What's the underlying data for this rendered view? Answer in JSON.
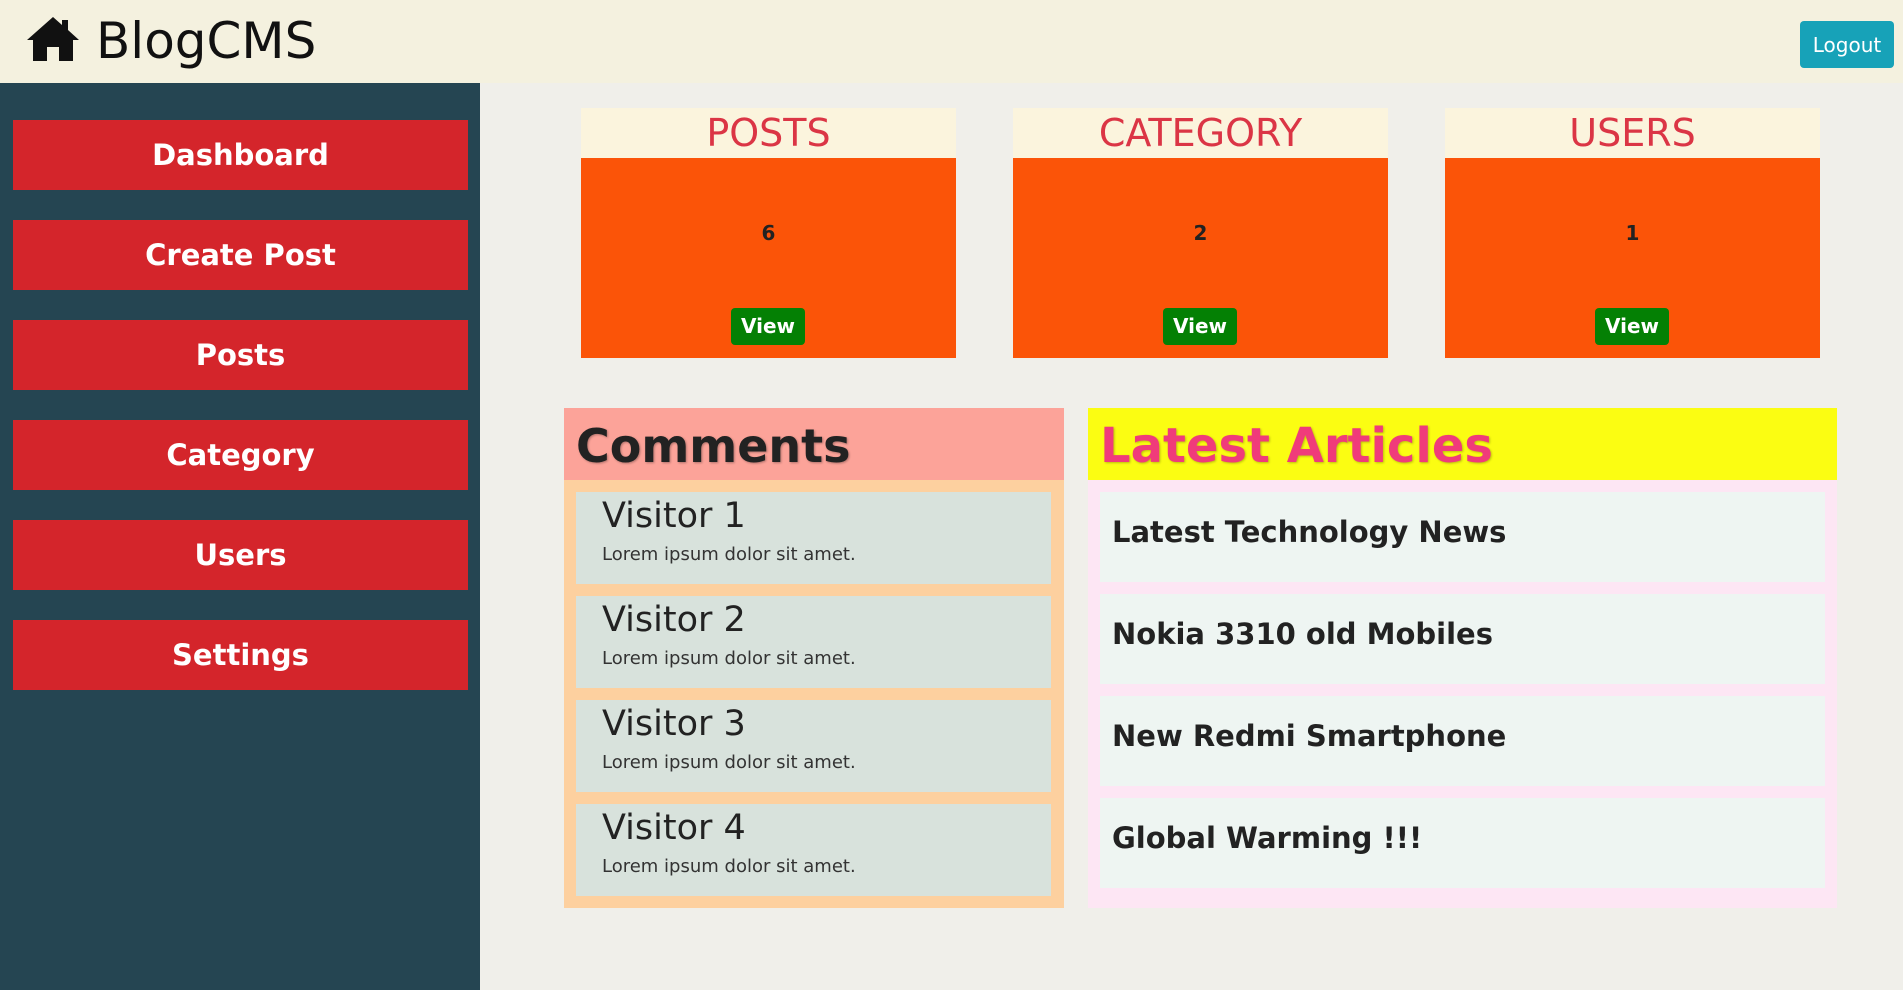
{
  "header": {
    "brand": "BlogCMS",
    "brand_icon": "home-icon",
    "logout_label": "Logout"
  },
  "sidebar": {
    "items": [
      {
        "label": "Dashboard"
      },
      {
        "label": "Create Post"
      },
      {
        "label": "Posts"
      },
      {
        "label": "Category"
      },
      {
        "label": "Users"
      },
      {
        "label": "Settings"
      }
    ]
  },
  "stats": [
    {
      "title": "POSTS",
      "count": "6",
      "button": "View"
    },
    {
      "title": "CATEGORY",
      "count": "2",
      "button": "View"
    },
    {
      "title": "USERS",
      "count": "1",
      "button": "View"
    }
  ],
  "comments": {
    "title": "Comments",
    "items": [
      {
        "name": "Visitor 1",
        "text": "Lorem ipsum dolor sit amet."
      },
      {
        "name": "Visitor 2",
        "text": "Lorem ipsum dolor sit amet."
      },
      {
        "name": "Visitor 3",
        "text": "Lorem ipsum dolor sit amet."
      },
      {
        "name": "Visitor 4",
        "text": "Lorem ipsum dolor sit amet."
      }
    ]
  },
  "articles": {
    "title": "Latest Articles",
    "items": [
      {
        "title": "Latest Technology News"
      },
      {
        "title": "Nokia 3310 old Mobiles"
      },
      {
        "title": "New Redmi Smartphone"
      },
      {
        "title": "Global Warming !!!"
      }
    ]
  },
  "colors": {
    "sidebar_bg": "#254552",
    "nav_button": "#d4252b",
    "stat_card": "#fb5408",
    "view_button": "#048004",
    "logout_button": "#17a2b8"
  }
}
